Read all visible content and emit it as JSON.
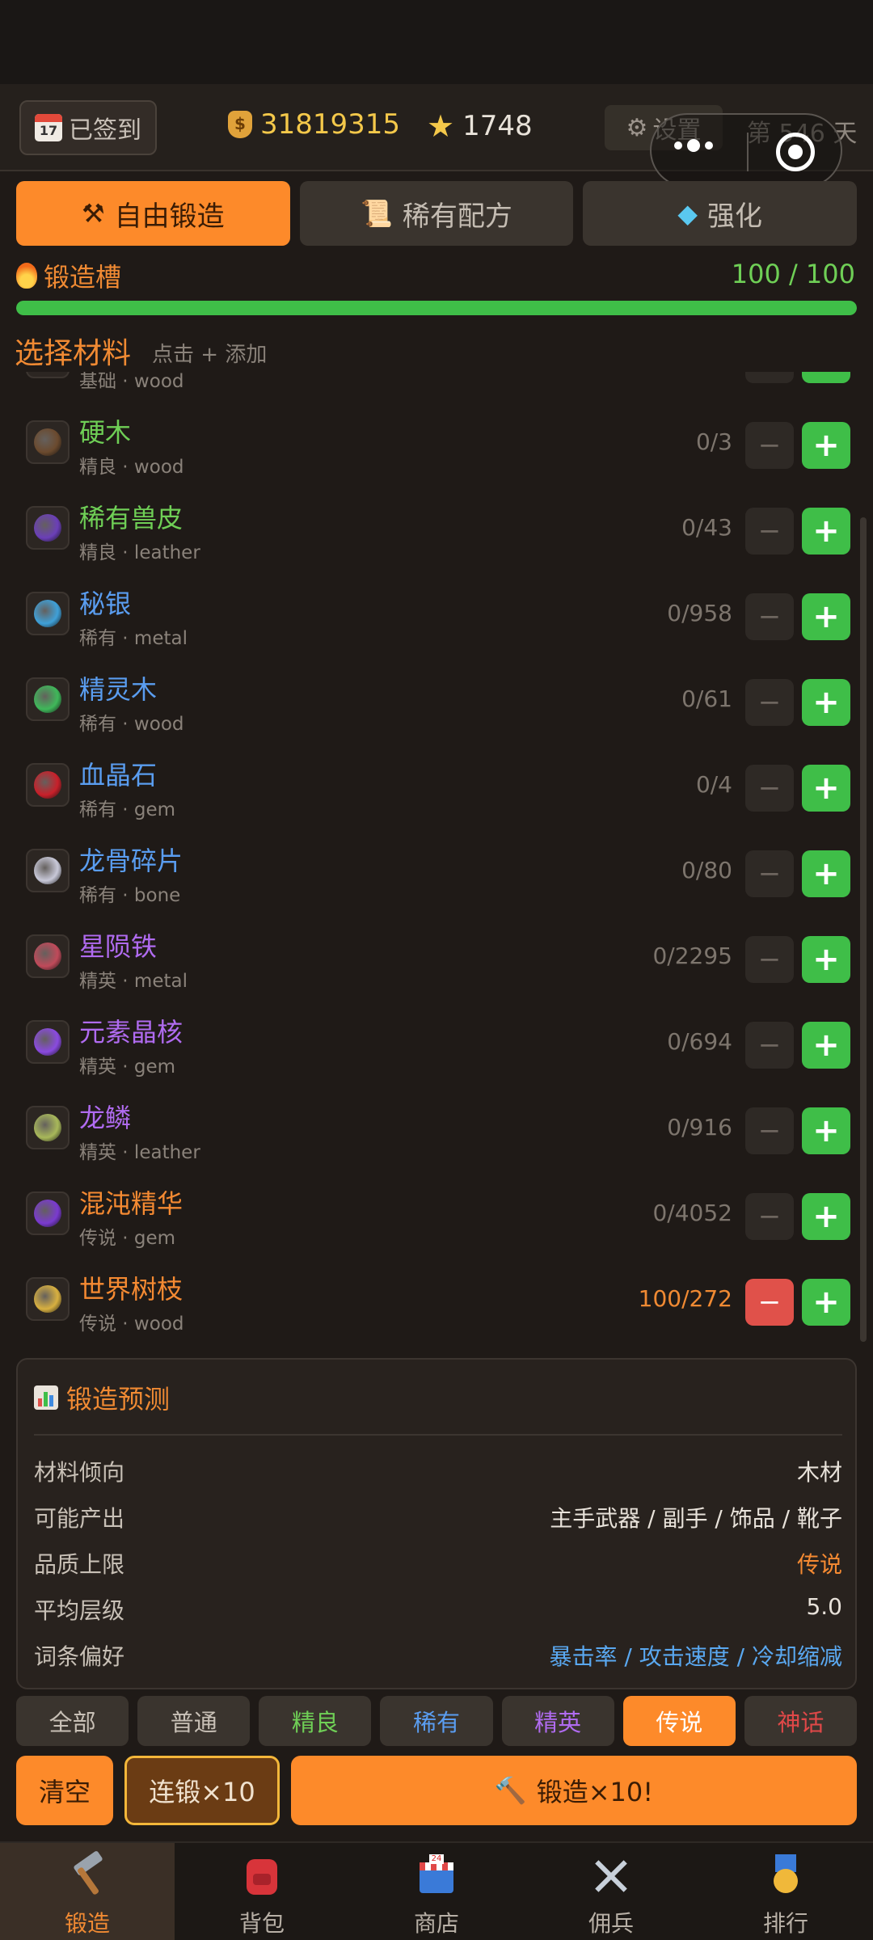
{
  "header": {
    "signed_label": "已签到",
    "calendar_day": "17",
    "gold": "31819315",
    "stars": "1748",
    "settings_label": "设置",
    "day_label": "第 546 天"
  },
  "tabs": [
    {
      "label": "自由锻造",
      "icon": "anvil-hammer-icon",
      "active": true
    },
    {
      "label": "稀有配方",
      "icon": "scroll-icon",
      "active": false
    },
    {
      "label": "强化",
      "icon": "diamond-icon",
      "active": false
    }
  ],
  "forge_slot": {
    "title": "锻造槽",
    "count": "100 / 100",
    "fill_fraction": 1.0
  },
  "select": {
    "title": "选择材料",
    "hint": "点击 + 添加"
  },
  "materials": [
    {
      "name": "基础",
      "meta": "基础 · wood",
      "qty": "",
      "quality": "common",
      "partial": true
    },
    {
      "name": "硬木",
      "meta": "精良 · wood",
      "qty": "0/3",
      "quality": "good",
      "color": "#6b4a2e"
    },
    {
      "name": "稀有兽皮",
      "meta": "精良 · leather",
      "qty": "0/43",
      "quality": "good",
      "color": "#6b3fb8"
    },
    {
      "name": "秘银",
      "meta": "稀有 · metal",
      "qty": "0/958",
      "quality": "rare",
      "color": "#3fa0d8"
    },
    {
      "name": "精灵木",
      "meta": "稀有 · wood",
      "qty": "0/61",
      "quality": "rare",
      "color": "#3fb85a"
    },
    {
      "name": "血晶石",
      "meta": "稀有 · gem",
      "qty": "0/4",
      "quality": "rare",
      "color": "#c8202a"
    },
    {
      "name": "龙骨碎片",
      "meta": "稀有 · bone",
      "qty": "0/80",
      "quality": "rare",
      "color": "#c8c8d8"
    },
    {
      "name": "星陨铁",
      "meta": "精英 · metal",
      "qty": "0/2295",
      "quality": "elite",
      "color": "#c04a5a"
    },
    {
      "name": "元素晶核",
      "meta": "精英 · gem",
      "qty": "0/694",
      "quality": "elite",
      "color": "#8a4ae0"
    },
    {
      "name": "龙鳞",
      "meta": "精英 · leather",
      "qty": "0/916",
      "quality": "elite",
      "color": "#a8b85a"
    },
    {
      "name": "混沌精华",
      "meta": "传说 · gem",
      "qty": "0/4052",
      "quality": "legend",
      "color": "#7a3ad0"
    },
    {
      "name": "世界树枝",
      "meta": "传说 · wood",
      "qty": "100/272",
      "quality": "legend",
      "color": "#d8b040",
      "selected": true
    }
  ],
  "prediction": {
    "title": "锻造预测",
    "rows": [
      {
        "key": "材料倾向",
        "value": "木材",
        "style": "plain"
      },
      {
        "key": "可能产出",
        "value": "主手武器 / 副手 / 饰品 / 靴子",
        "style": "plain"
      },
      {
        "key": "品质上限",
        "value": "传说",
        "style": "legend"
      },
      {
        "key": "平均层级",
        "value": "5.0",
        "style": "plain"
      },
      {
        "key": "词条偏好",
        "value": "暴击率 / 攻击速度 / 冷却缩减",
        "style": "affix"
      }
    ]
  },
  "filters": [
    {
      "label": "全部",
      "cls": ""
    },
    {
      "label": "普通",
      "cls": ""
    },
    {
      "label": "精良",
      "cls": "f-good"
    },
    {
      "label": "稀有",
      "cls": "f-rare"
    },
    {
      "label": "精英",
      "cls": "f-elite"
    },
    {
      "label": "传说",
      "cls": "",
      "active": true
    },
    {
      "label": "神话",
      "cls": "f-myth"
    }
  ],
  "actions": {
    "clear": "清空",
    "chain": "连锻×10",
    "forge": "锻造×10!"
  },
  "nav": [
    {
      "label": "锻造",
      "icon": "hammer-icon",
      "active": true
    },
    {
      "label": "背包",
      "icon": "backpack-icon"
    },
    {
      "label": "商店",
      "icon": "shop-icon"
    },
    {
      "label": "佣兵",
      "icon": "crossed-swords-icon"
    },
    {
      "label": "排行",
      "icon": "medal-icon"
    }
  ],
  "colors": {
    "accent": "#fd8a2a",
    "good": "#6fcf56",
    "rare": "#5a9df0",
    "elite": "#b06bf0",
    "legend": "#f58a32",
    "myth": "#e04848"
  }
}
